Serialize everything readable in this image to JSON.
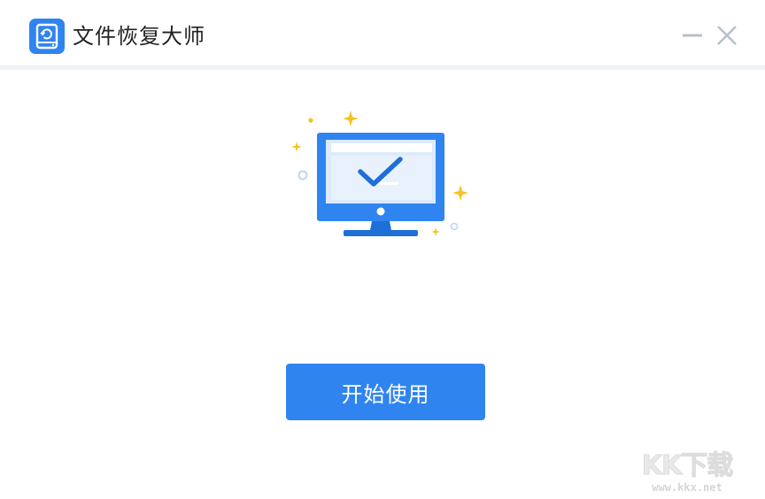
{
  "window": {
    "title": "文件恢复大师",
    "app_icon": "hard-drive-recovery-icon",
    "controls": {
      "minimize_icon": "minimize-icon",
      "close_icon": "close-icon"
    }
  },
  "main": {
    "illustration": "monitor-checkmark-illustration",
    "start_button_label": "开始使用"
  },
  "watermark": {
    "logo_text": "KK下载",
    "url": "www.kkx.net"
  },
  "colors": {
    "accent": "#2f84f0",
    "titlebar_divider": "#eef3fa",
    "sparkle": "#f7c21d"
  }
}
